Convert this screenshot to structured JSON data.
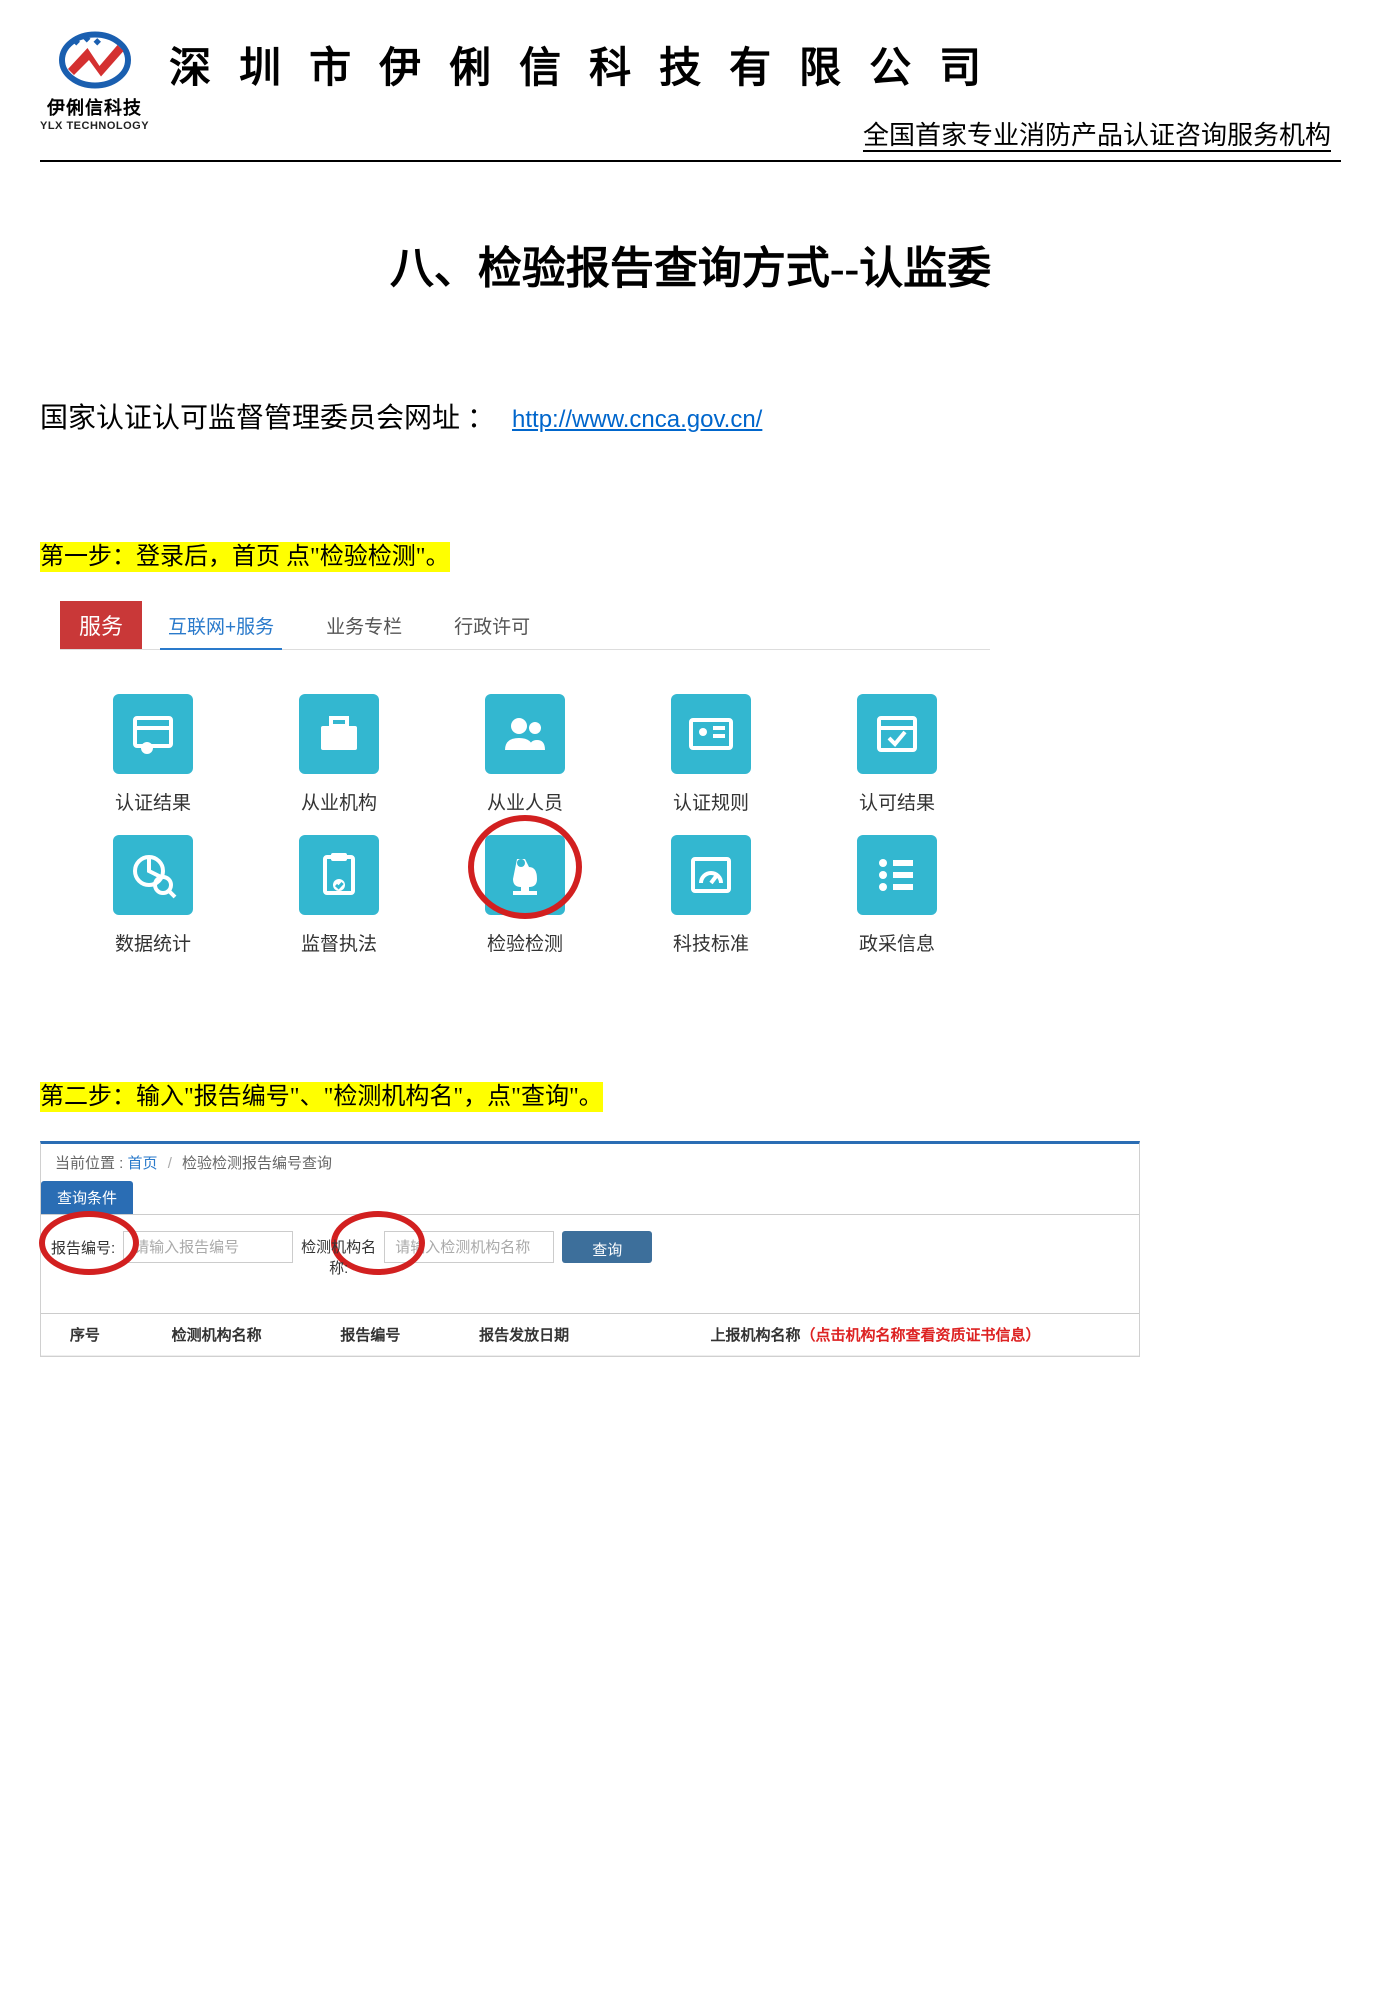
{
  "header": {
    "company_name": "深圳市伊俐信科技有限公司",
    "logo_text": "伊俐信科技",
    "logo_sub": "YLX TECHNOLOGY",
    "tagline": "全国首家专业消防产品认证咨询服务机构"
  },
  "title": "八、检验报告查询方式--认监委",
  "url_label": "国家认证认可监督管理委员会网址 ：",
  "url": "http://www.cnca.gov.cn/",
  "step1": "第一步：登录后，首页 点\"检验检测\"。",
  "step2": "第二步：输入\"报告编号\"、\"检测机构名\"，点\"查询\"。",
  "shot1": {
    "svc": "服务",
    "tabs": [
      "互联网+服务",
      "业务专栏",
      "行政许可"
    ],
    "items": [
      "认证结果",
      "从业机构",
      "从业人员",
      "认证规则",
      "认可结果",
      "数据统计",
      "监督执法",
      "检验检测",
      "科技标准",
      "政采信息"
    ]
  },
  "shot2": {
    "bc_label": "当前位置 :",
    "bc_home": "首页",
    "bc_page": "检验检测报告编号查询",
    "panel_tab": "查询条件",
    "label_report": "报告编号:",
    "ph_report": "请输入报告编号",
    "label_org1": "检测机构名",
    "label_org2": "称:",
    "ph_org": "请输入检测机构名称",
    "btn_search": "查询",
    "th": [
      "序号",
      "检测机构名称",
      "报告编号",
      "报告发放日期"
    ],
    "th_last_a": "上报机构名称",
    "th_last_b": "（点击机构名称查看资质证书信息）"
  }
}
